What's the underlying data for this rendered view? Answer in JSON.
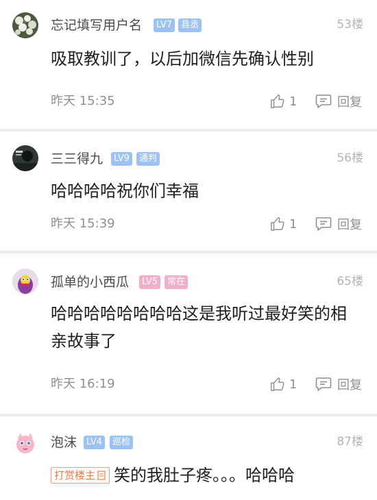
{
  "comments": [
    {
      "username": "忘记填写用户名",
      "level": "LV7",
      "role": "县丞",
      "floor": "53楼",
      "text": "吸取教训了，以后加微信先确认性别",
      "time": "昨天 15:35",
      "likes": "1",
      "reply_label": "回复",
      "avatar_icon": "flower-bush-avatar"
    },
    {
      "username": "三三得九",
      "level": "LV9",
      "role": "通判",
      "floor": "56楼",
      "text": "哈哈哈哈祝你们幸福",
      "time": "昨天 15:39",
      "likes": "1",
      "reply_label": "回复",
      "avatar_icon": "dark-photo-avatar"
    },
    {
      "username": "孤单的小西瓜",
      "level": "LV5",
      "role": "常在",
      "floor": "65楼",
      "text": "哈哈哈哈哈哈哈哈这是我听过最好笑的相亲故事了",
      "time": "昨天 16:19",
      "likes": "1",
      "reply_label": "回复",
      "avatar_icon": "cartoon-character-avatar"
    },
    {
      "username": "泡沫",
      "level": "LV4",
      "role": "巡检",
      "floor": "87楼",
      "reward_tag": "打赏楼主",
      "text": "笑的我肚子疼。。。哈哈哈",
      "avatar_icon": "pink-puff-avatar"
    }
  ],
  "colors": {
    "badge_blue": "#9cc2f2",
    "badge_pink": "#f3aec9",
    "reward_orange": "#f07a46",
    "separator": "#ececec"
  }
}
